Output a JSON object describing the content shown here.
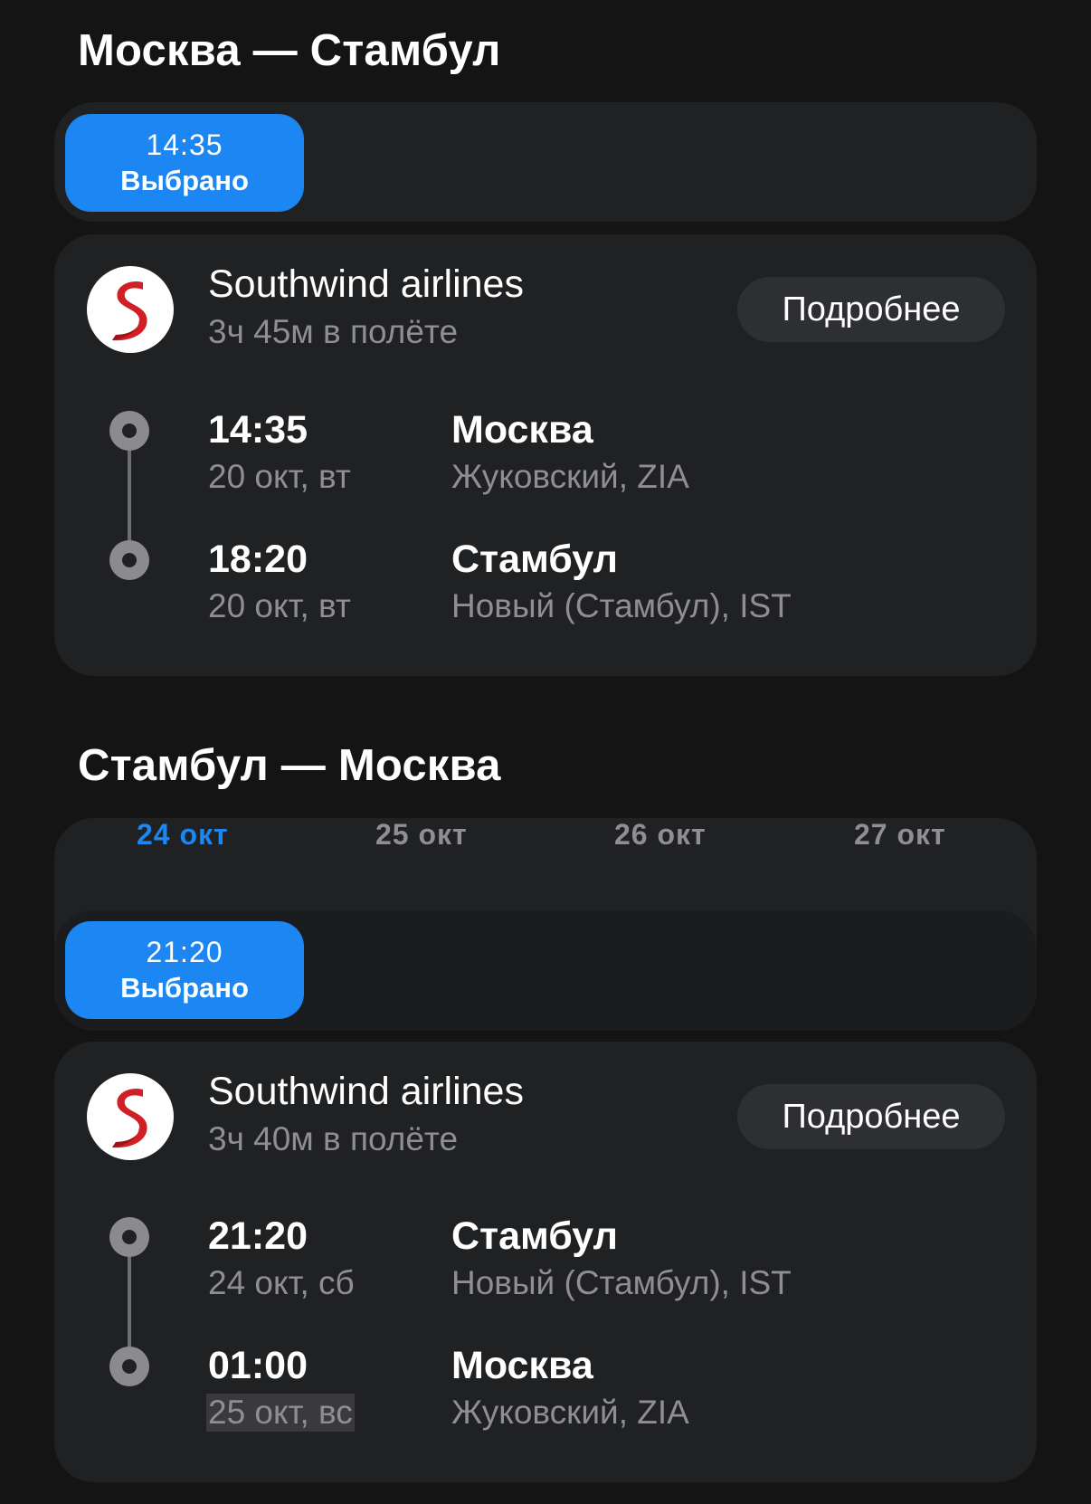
{
  "outbound": {
    "title": "Москва — Стамбул",
    "chip": {
      "time": "14:35",
      "label": "Выбрано"
    },
    "card": {
      "airline": "Southwind airlines",
      "duration": "3ч 45м в полёте",
      "details_label": "Подробнее",
      "departure": {
        "time": "14:35",
        "date": "20 окт, вт",
        "city": "Москва",
        "airport": "Жуковский, ZIA"
      },
      "arrival": {
        "time": "18:20",
        "date": "20 окт, вт",
        "city": "Стамбул",
        "airport": "Новый (Стамбул), IST"
      }
    }
  },
  "return": {
    "title": "Стамбул — Москва",
    "dates": [
      "24 окт",
      "25 окт",
      "26 окт",
      "27 окт"
    ],
    "selected_date_index": 0,
    "chip": {
      "time": "21:20",
      "label": "Выбрано"
    },
    "card": {
      "airline": "Southwind airlines",
      "duration": "3ч 40м в полёте",
      "details_label": "Подробнее",
      "departure": {
        "time": "21:20",
        "date": "24 окт, сб",
        "city": "Стамбул",
        "airport": "Новый (Стамбул), IST"
      },
      "arrival": {
        "time": "01:00",
        "date": "25 окт, вс",
        "city": "Москва",
        "airport": "Жуковский, ZIA"
      }
    }
  },
  "colors": {
    "accent": "#1c86f2",
    "background": "#141415",
    "card": "#202123",
    "logo_red": "#d11f26"
  },
  "icons": {
    "airline_logo": "southwind-logo-icon",
    "timeline_node": "timeline-dot-icon"
  }
}
